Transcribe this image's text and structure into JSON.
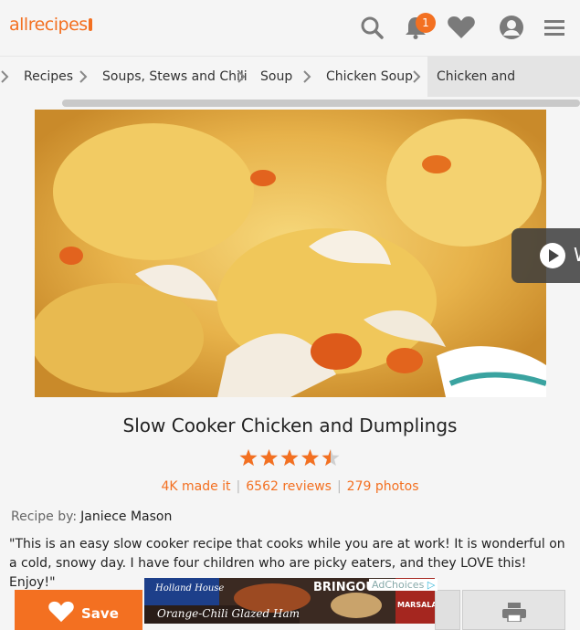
{
  "header": {
    "logo_text": "allrecipes",
    "notification_count": "1",
    "icons": [
      "search-icon",
      "bell-icon",
      "heart-icon",
      "profile-icon",
      "menu-icon"
    ]
  },
  "breadcrumb": {
    "items": [
      "Recipes",
      "Soups, Stews and Chili",
      "Soup",
      "Chicken Soup",
      "Chicken and Dumplings"
    ]
  },
  "video": {
    "label_partial": "W"
  },
  "recipe": {
    "title": "Slow Cooker Chicken and Dumplings",
    "rating": 4.5,
    "made_it": "4K made it",
    "reviews": "6562 reviews",
    "photos": "279 photos",
    "by_label": "Recipe by:",
    "author": "Janiece Mason",
    "description": "\"This is an easy slow cooker recipe that cooks while you are at work! It is wonderful on a cold, snowy day. I have four children who are picky eaters, and they LOVE this! Enjoy!\""
  },
  "actions": {
    "save_label": "Save"
  },
  "ad": {
    "brand": "Holland House",
    "headline": "Orange-Chili Glazed Ham",
    "tagline": "BRINGOUT",
    "side_label": "MARSALA",
    "adchoices": "AdChoices"
  },
  "colors": {
    "accent": "#f37021",
    "icon_gray": "#7a7a7a"
  }
}
